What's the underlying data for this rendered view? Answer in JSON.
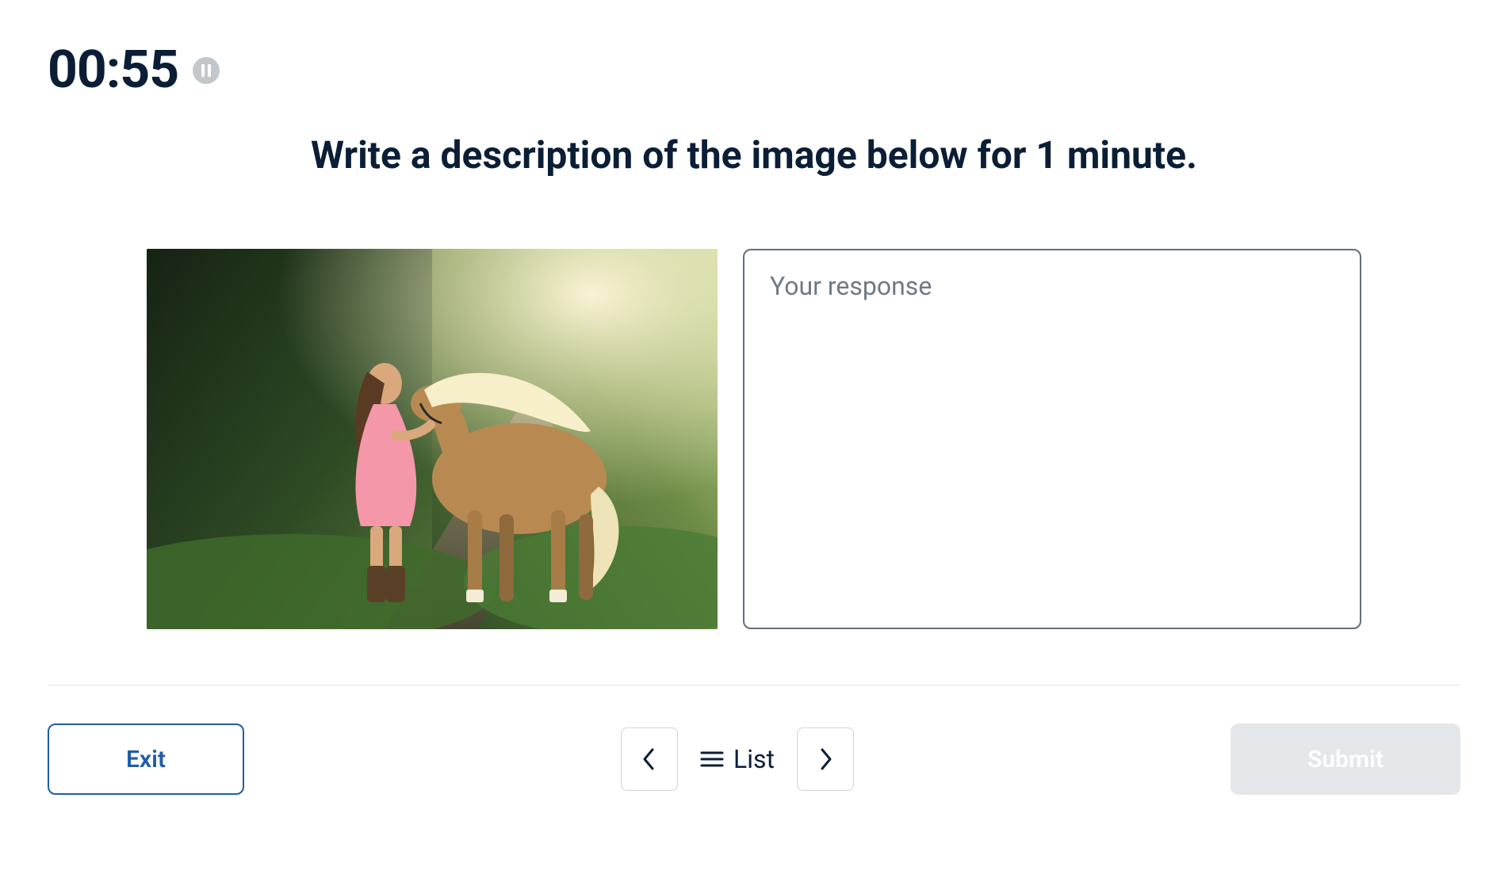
{
  "timer": {
    "value": "00:55"
  },
  "prompt": {
    "text": "Write a description of the image below for 1 minute."
  },
  "response": {
    "placeholder": "Your response",
    "value": ""
  },
  "image": {
    "alt": "woman in pink dress standing with a palomino horse on a forest path"
  },
  "footer": {
    "exit_label": "Exit",
    "list_label": "List",
    "submit_label": "Submit"
  }
}
